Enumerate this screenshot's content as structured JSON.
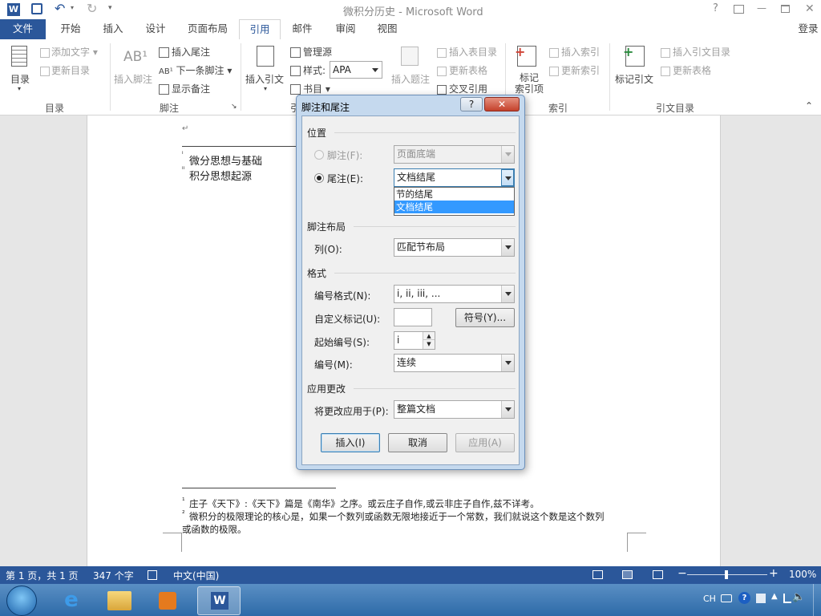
{
  "titlebar": {
    "title": "微积分历史 - Microsoft Word",
    "help": "?",
    "restore_ribbon": "□",
    "min": "—",
    "max": "□",
    "close": "✕",
    "login": "登录"
  },
  "tabs": [
    "文件",
    "开始",
    "插入",
    "设计",
    "页面布局",
    "引用",
    "邮件",
    "审阅",
    "视图"
  ],
  "ribbon": {
    "toc": {
      "label": "目录",
      "add_text": "添加文字",
      "update": "更新目录",
      "group": "目录"
    },
    "footnote": {
      "insert_footnote": "插入脚注",
      "insert_endnote": "插入尾注",
      "next_footnote": "下一条脚注",
      "show_notes": "显示备注",
      "group": "脚注"
    },
    "citation": {
      "insert_citation": "插入引文",
      "manage_sources": "管理源",
      "style_label": "样式:",
      "style_value": "APA",
      "bibliography": "书目",
      "group": "引"
    },
    "caption": {
      "insert_caption": "插入题注",
      "insert_table_figures": "插入表目录",
      "update_table": "更新表格",
      "cross_ref": "交叉引用"
    },
    "index": {
      "mark_entry": "标记\n索引项",
      "insert_index": "插入索引",
      "update_index": "更新索引",
      "group": "索引"
    },
    "toa": {
      "mark_citation": "标记引文",
      "insert_toa": "插入引文目录",
      "update_table": "更新表格",
      "group": "引文目录"
    }
  },
  "document": {
    "para_mark": "↵",
    "note1": "微分思想与基础",
    "note2": "积分思想起源",
    "fn1": "庄子《天下》:《天下》篇是《南华》之序。或云庄子自作,或云非庄子自作,兹不详考。",
    "fn2a": "微积分的极限理论的核心是，如果一个数列或函数无限地接近于一个常数，我们就说这个数是这个数列",
    "fn2b": "或函数的极限。",
    "sup1": "¹",
    "sup2": "²",
    "supi": "ⁱ",
    "supii": "ⁱⁱ"
  },
  "dialog": {
    "title": "脚注和尾注",
    "help": "?",
    "close": "✕",
    "position_section": "位置",
    "footnote_label": "脚注(F):",
    "footnote_value": "页面底端",
    "endnote_label": "尾注(E):",
    "endnote_value": "文档结尾",
    "dropdown_options": [
      "节的结尾",
      "文档结尾"
    ],
    "layout_section": "脚注布局",
    "columns_label": "列(O):",
    "columns_value": "匹配节布局",
    "format_section": "格式",
    "number_format_label": "编号格式(N):",
    "number_format_value": "i, ii, iii, ...",
    "custom_mark_label": "自定义标记(U):",
    "custom_mark_value": "",
    "symbol_button": "符号(Y)...",
    "start_at_label": "起始编号(S):",
    "start_at_value": "i",
    "numbering_label": "编号(M):",
    "numbering_value": "连续",
    "apply_section": "应用更改",
    "apply_to_label": "将更改应用于(P):",
    "apply_to_value": "整篇文档",
    "insert_button": "插入(I)",
    "cancel_button": "取消",
    "apply_button": "应用(A)"
  },
  "status": {
    "page": "第 1 页，共 1 页",
    "words": "347 个字",
    "lang": "中文(中国)",
    "zoom": "100%"
  },
  "taskbar": {
    "tray_lang": "CH"
  },
  "colors": {
    "accent": "#2b579a",
    "selection": "#3399ff"
  }
}
